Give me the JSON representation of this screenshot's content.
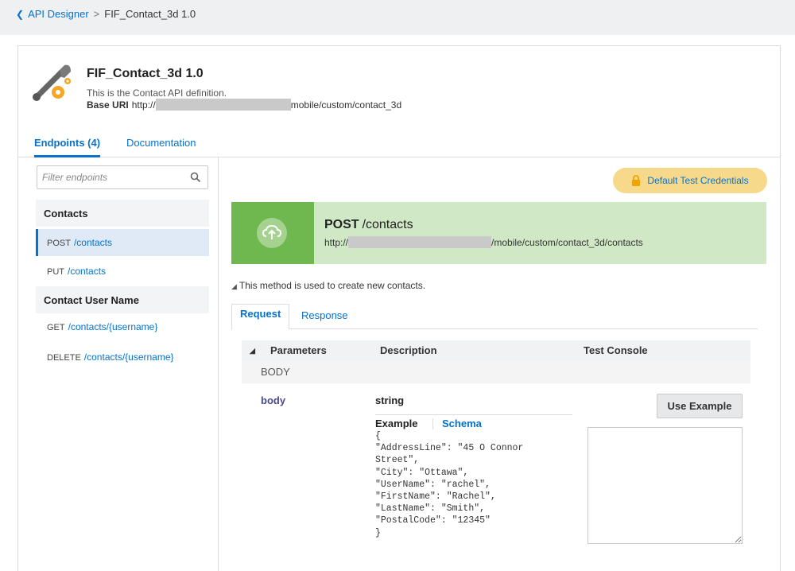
{
  "breadcrumb": {
    "back_icon": "chevron-left-icon",
    "parent": "API Designer",
    "separator": ">",
    "current": "FIF_Contact_3d 1.0"
  },
  "api": {
    "title": "FIF_Contact_3d 1.0",
    "description": "This is the Contact API definition.",
    "base_uri_label": "Base URI",
    "base_uri_prefix": "http://",
    "base_uri_suffix": "mobile/custom/contact_3d",
    "icon": "wrench-gear-icon"
  },
  "tabs": {
    "endpoints": "Endpoints (4)",
    "documentation": "Documentation"
  },
  "sidebar": {
    "filter_placeholder": "Filter endpoints",
    "groups": [
      {
        "name": "Contacts",
        "endpoints": [
          {
            "verb": "POST",
            "path": "/contacts",
            "selected": true
          },
          {
            "verb": "PUT",
            "path": "/contacts",
            "selected": false
          }
        ]
      },
      {
        "name": "Contact User Name",
        "endpoints": [
          {
            "verb": "GET",
            "path": "/contacts/{username}",
            "selected": false
          },
          {
            "verb": "DELETE",
            "path": "/contacts/{username}",
            "selected": false
          }
        ]
      }
    ]
  },
  "credentials_button": "Default Test Credentials",
  "method": {
    "verb": "POST",
    "path": "/contacts",
    "url_prefix": "http://",
    "url_suffix": "/mobile/custom/contact_3d/contacts",
    "description": "This method is used to create new contacts.",
    "icon": "cloud-upload-icon"
  },
  "sub_tabs": {
    "request": "Request",
    "response": "Response"
  },
  "params_table": {
    "headers": [
      "Parameters",
      "Description",
      "Test Console"
    ],
    "section": "BODY",
    "param_name": "body",
    "param_type": "string",
    "example_tab": "Example",
    "schema_tab": "Schema",
    "example_code": "{\n\"AddressLine\": \"45 O Connor\nStreet\",\n\"City\": \"Ottawa\",\n\"UserName\": \"rachel\",\n\"FirstName\": \"Rachel\",\n\"LastName\": \"Smith\",\n\"PostalCode\": \"12345\"\n}"
  },
  "use_example_button": "Use Example",
  "colors": {
    "link": "#0572ce",
    "banner_bg": "#d1e8c6",
    "banner_icon_bg": "#6fb850",
    "credentials_bg": "#f7d98b"
  }
}
